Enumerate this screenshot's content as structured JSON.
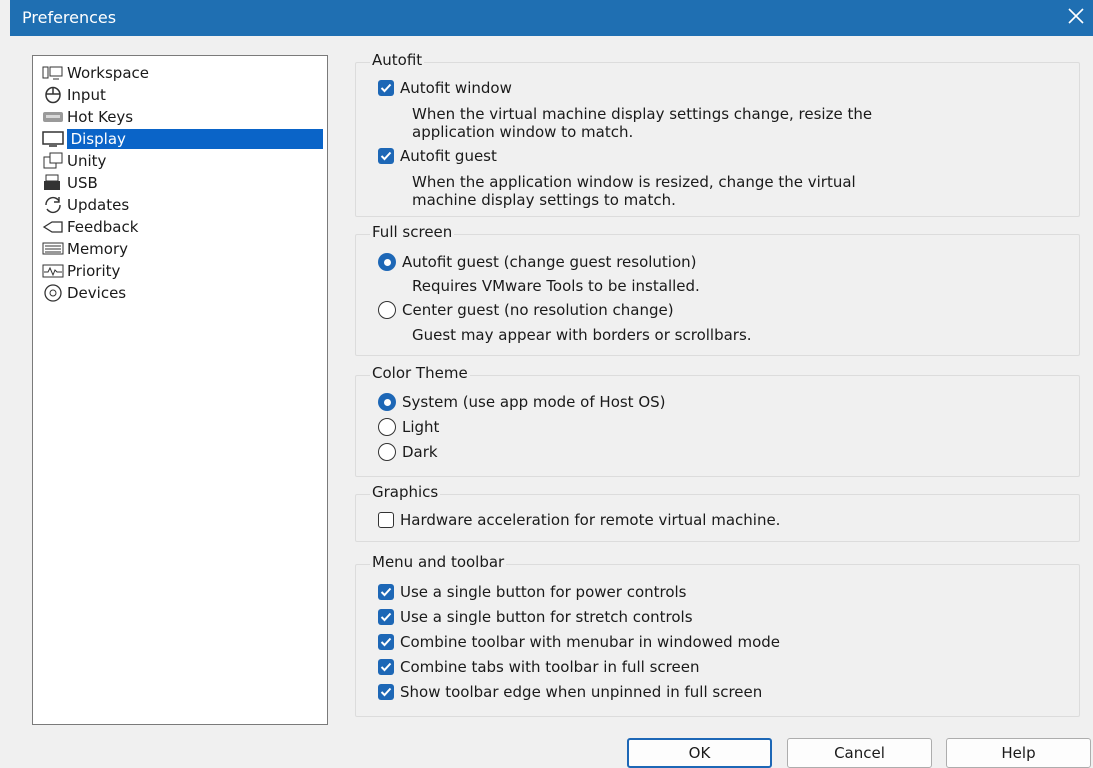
{
  "window": {
    "title": "Preferences"
  },
  "nav": {
    "items": [
      {
        "label": "Workspace",
        "icon": "workspace-icon"
      },
      {
        "label": "Input",
        "icon": "input-icon"
      },
      {
        "label": "Hot Keys",
        "icon": "hotkeys-icon"
      },
      {
        "label": "Display",
        "icon": "display-icon",
        "selected": true
      },
      {
        "label": "Unity",
        "icon": "unity-icon"
      },
      {
        "label": "USB",
        "icon": "usb-icon"
      },
      {
        "label": "Updates",
        "icon": "updates-icon"
      },
      {
        "label": "Feedback",
        "icon": "feedback-icon"
      },
      {
        "label": "Memory",
        "icon": "memory-icon"
      },
      {
        "label": "Priority",
        "icon": "priority-icon"
      },
      {
        "label": "Devices",
        "icon": "devices-icon"
      }
    ]
  },
  "autofit": {
    "title": "Autofit",
    "window_label": "Autofit window",
    "window_checked": true,
    "window_desc_1": "When the virtual machine display settings change, resize the",
    "window_desc_2": "application window to match.",
    "guest_label": "Autofit guest",
    "guest_checked": true,
    "guest_desc_1": "When the application window is resized, change the virtual",
    "guest_desc_2": "machine display settings to match."
  },
  "fullscreen": {
    "title": "Full screen",
    "option1_label": "Autofit guest (change guest resolution)",
    "option1_desc": "Requires VMware Tools to be installed.",
    "option2_label": "Center guest (no resolution change)",
    "option2_desc": "Guest may appear with borders or scrollbars.",
    "selected": "option1"
  },
  "theme": {
    "title": "Color Theme",
    "options": [
      "System (use app mode of Host OS)",
      "Light",
      "Dark"
    ],
    "selected": "System (use app mode of Host OS)"
  },
  "graphics": {
    "title": "Graphics",
    "hw_accel_label": "Hardware acceleration for remote virtual machine.",
    "hw_accel_checked": false
  },
  "menu_toolbar": {
    "title": "Menu and toolbar",
    "items": [
      "Use a single button for power controls",
      "Use a single button for stretch controls",
      "Combine toolbar with menubar in windowed mode",
      "Combine tabs with toolbar in full screen",
      "Show toolbar edge when unpinned in full screen"
    ],
    "checked": [
      true,
      true,
      true,
      true,
      true
    ]
  },
  "buttons": {
    "ok": "OK",
    "cancel": "Cancel",
    "help": "Help"
  },
  "colors": {
    "titlebar": "#1f6fb2",
    "accent": "#1d67b6",
    "selection": "#0a64c8"
  }
}
